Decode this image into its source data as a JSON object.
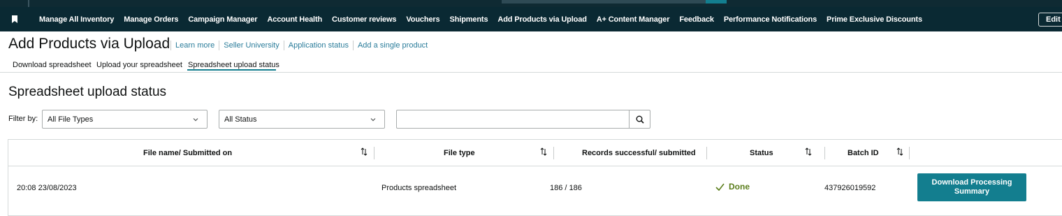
{
  "navbar": {
    "items": [
      "Manage All Inventory",
      "Manage Orders",
      "Campaign Manager",
      "Account Health",
      "Customer reviews",
      "Vouchers",
      "Shipments",
      "Add Products via Upload",
      "A+ Content Manager",
      "Feedback",
      "Performance Notifications",
      "Prime Exclusive Discounts"
    ],
    "edit_label": "Edit"
  },
  "page": {
    "title": "Add Products via Upload",
    "links": [
      "Learn more",
      "Seller University",
      "Application status",
      "Add a single product"
    ]
  },
  "tabs": [
    {
      "label": "Download spreadsheet",
      "active": false
    },
    {
      "label": "Upload your spreadsheet",
      "active": false
    },
    {
      "label": "Spreadsheet upload status",
      "active": true
    }
  ],
  "section": {
    "title": "Spreadsheet upload status"
  },
  "filters": {
    "label": "Filter by:",
    "file_type_selected": "All File Types",
    "status_selected": "All Status",
    "search_value": "",
    "search_placeholder": ""
  },
  "table": {
    "columns": [
      "File name/ Submitted on",
      "File type",
      "Records successful/ submitted",
      "Status",
      "Batch ID"
    ],
    "rows": [
      {
        "submitted_on": "20:08 23/08/2023",
        "file_type": "Products spreadsheet",
        "records": "186 / 186",
        "status": "Done",
        "batch_id": "437926019592",
        "action_label_line1": "Download Processing",
        "action_label_line2": "Summary"
      }
    ]
  },
  "colors": {
    "nav_bg": "#0a2933",
    "accent_teal": "#137e8f",
    "link": "#2a7c9a",
    "status_done": "#5b7e1c"
  },
  "icons": {
    "nav_left": "bookmark-icon",
    "sort": "sort-arrows-icon",
    "search": "search-icon",
    "dropdown": "chevron-down-icon",
    "status": "checkmark-icon"
  }
}
